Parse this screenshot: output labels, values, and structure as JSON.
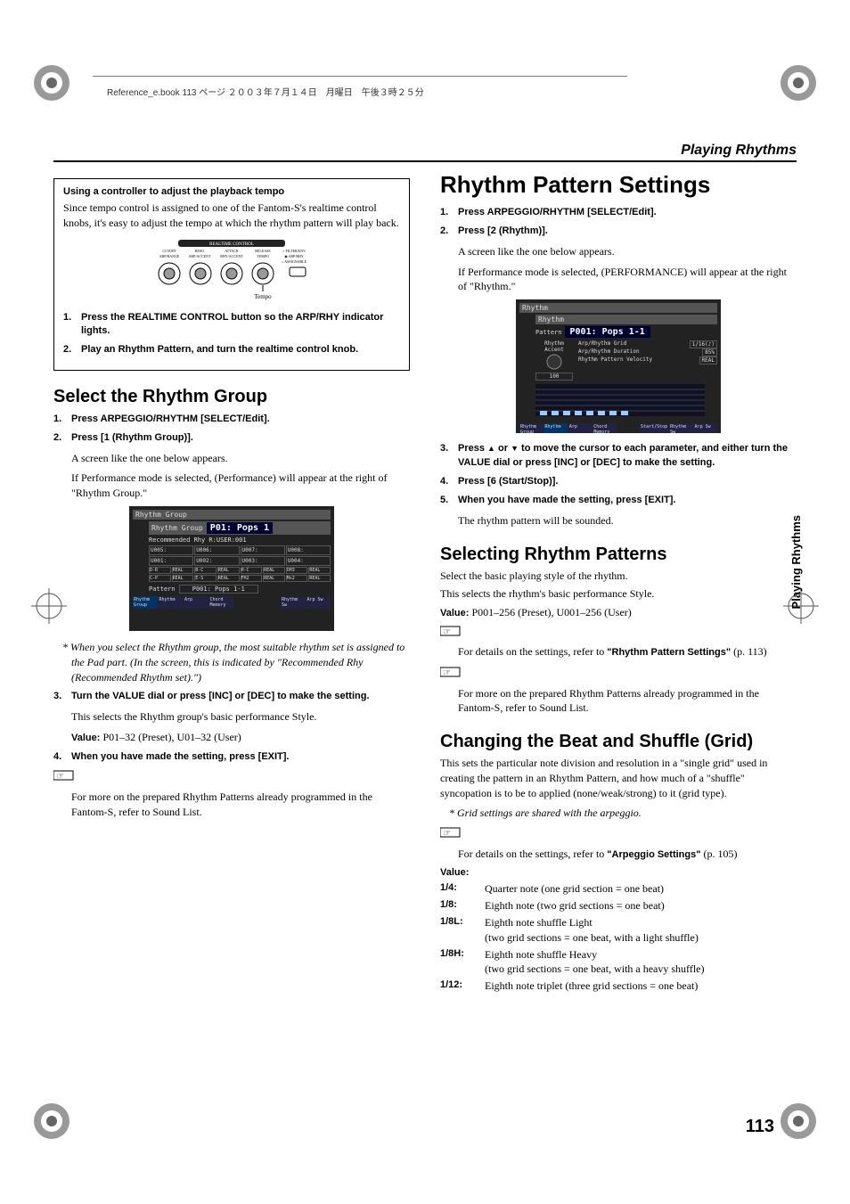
{
  "crumb_text": "Reference_e.book  113 ページ  ２００３年７月１４日　月曜日　午後３時２５分",
  "section_header": "Playing Rhythms",
  "side_tab": "Playing Rhythms",
  "page_number": "113",
  "left": {
    "box": {
      "subhead": "Using a controller to adjust the playback tempo",
      "body": "Since tempo control is assigned to one of the Fantom-S's realtime control knobs, it's easy to adjust the tempo at which the rhythm pattern will play back.",
      "knob_caption_top": "REALTIME CONTROL",
      "knob_labels": [
        "CUTOFF",
        "RESO",
        "ATTACK",
        "RELEASE",
        "FILTER/ENV",
        "ARP/RANGE",
        "ARP/ACCENT",
        "RHY/ACCENT",
        "TEMPO",
        "ARP/RHY",
        "ASSIGNABLE"
      ],
      "knob_caption": "Tempo",
      "step1": "Press the REALTIME CONTROL button so the ARP/RHY indicator lights.",
      "step2": "Play an Rhythm Pattern, and turn the realtime control knob."
    },
    "h2": "Select the Rhythm Group",
    "s1": "Press ARPEGGIO/RHYTHM [SELECT/Edit].",
    "s2": "Press [1 (Rhythm Group)].",
    "s2_body_a": "A screen like the one below appears.",
    "s2_body_b": "If Performance mode is selected, (Performance) will appear at the right of \"Rhythm Group.\"",
    "screen_a": {
      "title": "Rhythm Group",
      "sub": "Rhythm Group",
      "label": "P01: Pops 1",
      "rec": "Recommended Rhy  R:USER:001",
      "grid": [
        "U005:",
        "U006:",
        "U007:",
        "U008:",
        "U001:",
        "U002:",
        "U003:",
        "U004:"
      ],
      "grid_lbls": [
        "D-R",
        "REAL",
        "B-C",
        "REAL",
        "H-C",
        "REAL",
        "OH3",
        "REAL",
        "C-P",
        "REAL",
        "E-S",
        "REAL",
        "FH2",
        "REAL",
        "Ms2",
        "REAL"
      ],
      "pattern": "Pattern",
      "pattern_v": "P001: Pops 1-1",
      "btns": [
        "Rhythm Group",
        "Rhythm",
        "Arp",
        "Chord Memory",
        "",
        "",
        "Rhythm Sw",
        "Arp Sw"
      ]
    },
    "note1": "* When you select the Rhythm group, the most suitable rhythm set is assigned to the Pad part. (In the screen, this is indicated by \"Recommended Rhy (Recommended Rhythm set).\")",
    "s3": "Turn the VALUE dial or press [INC] or [DEC] to make the setting.",
    "s3_body": "This selects the Rhythm group's basic performance Style.",
    "s3_value_lbl": "Value: ",
    "s3_value": "P01–32 (Preset), U01–32 (User)",
    "s4": "When you have made the setting, press [EXIT].",
    "hand_note": "For more on the prepared Rhythm Patterns already programmed in the Fantom-S, refer to Sound List."
  },
  "right": {
    "h1": "Rhythm Pattern Settings",
    "s1": "Press ARPEGGIO/RHYTHM [SELECT/Edit].",
    "s2": "Press [2 (Rhythm)].",
    "s2a": "A screen like the one below appears.",
    "s2b": "If Performance mode is selected, (PERFORMANCE) will appear at the right of \"Rhythm.\"",
    "screen_b": {
      "title": "Rhythm",
      "sub": "Rhythm",
      "pattern_lbl": "Pattern",
      "pattern_v": "P001: Pops 1-1",
      "accent": "Rhythm Accent",
      "lines": [
        "Arp/Rhythm Grid",
        "Arp/Rhythm Duration",
        "Rhythm Pattern Velocity"
      ],
      "vals": [
        "1/16(♪)",
        "85%",
        "REAL"
      ],
      "btns": [
        "Rhythm Group",
        "Rhythm",
        "Arp",
        "Chord Memory",
        "",
        "Start/Stop",
        "Rhythm Sw",
        "Arp Sw"
      ],
      "accent_val": "100"
    },
    "s3a": "Press ",
    "s3b": " or ",
    "s3c": " to move the cursor to each parameter, and either turn the VALUE dial or press [INC] or [DEC] to make the setting.",
    "s4": "Press [6 (Start/Stop)].",
    "s5": "When you have made the setting, press [EXIT].",
    "s5_body": "The rhythm pattern will be sounded.",
    "h2a": "Selecting Rhythm Patterns",
    "pa": "Select the basic playing style of the rhythm.",
    "pb": "This selects the rhythm's basic performance Style.",
    "pc_lbl": "Value: ",
    "pc": "P001–256 (Preset), U001–256 (User)",
    "hand_a_pre": "For details on the settings, refer to ",
    "hand_a_bold": "\"Rhythm Pattern Settings\"",
    "hand_a_post": " (p. 113)",
    "hand_b": "For more on the prepared Rhythm Patterns already programmed in the Fantom-S, refer to Sound List.",
    "h2b": "Changing the Beat and Shuffle (Grid)",
    "pd": "This sets the particular note division and resolution in a \"single grid\" used in creating the pattern in an Rhythm Pattern, and how much of a \"shuffle\" syncopation is to be to applied (none/weak/strong) to it (grid type).",
    "note2": "* Grid settings are shared with the arpeggio.",
    "hand_c_pre": "For details on the settings, refer to ",
    "hand_c_bold": "\"Arpeggio Settings\"",
    "hand_c_post": " (p. 105)",
    "value_lbl": "Value:",
    "values": [
      {
        "k": "1/4:",
        "v": "Quarter note (one grid section = one beat)"
      },
      {
        "k": "1/8:",
        "v": "Eighth note (two grid sections = one beat)"
      },
      {
        "k": "1/8L:",
        "v": "Eighth note shuffle Light\n(two grid sections = one beat, with a light shuffle)"
      },
      {
        "k": "1/8H:",
        "v": "Eighth note shuffle Heavy\n(two grid sections = one beat, with a heavy shuffle)"
      },
      {
        "k": "1/12:",
        "v": "Eighth note triplet (three grid sections = one beat)"
      }
    ]
  }
}
